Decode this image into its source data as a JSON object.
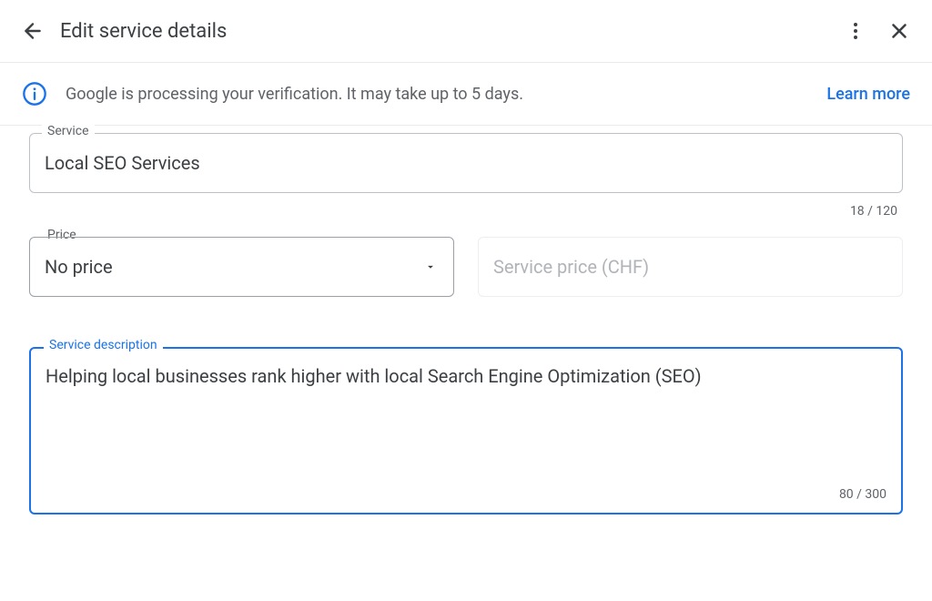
{
  "header": {
    "title": "Edit service details"
  },
  "banner": {
    "message": "Google is processing your verification. It may take up to 5 days.",
    "learn_more": "Learn more"
  },
  "service": {
    "label": "Service",
    "value": "Local SEO Services",
    "count": "18 / 120"
  },
  "price": {
    "label": "Price",
    "selected": "No price",
    "placeholder": "Service price (CHF)"
  },
  "description": {
    "label": "Service description",
    "value": "Helping local businesses rank higher with local Search Engine Optimization (SEO)",
    "count": "80 / 300"
  }
}
